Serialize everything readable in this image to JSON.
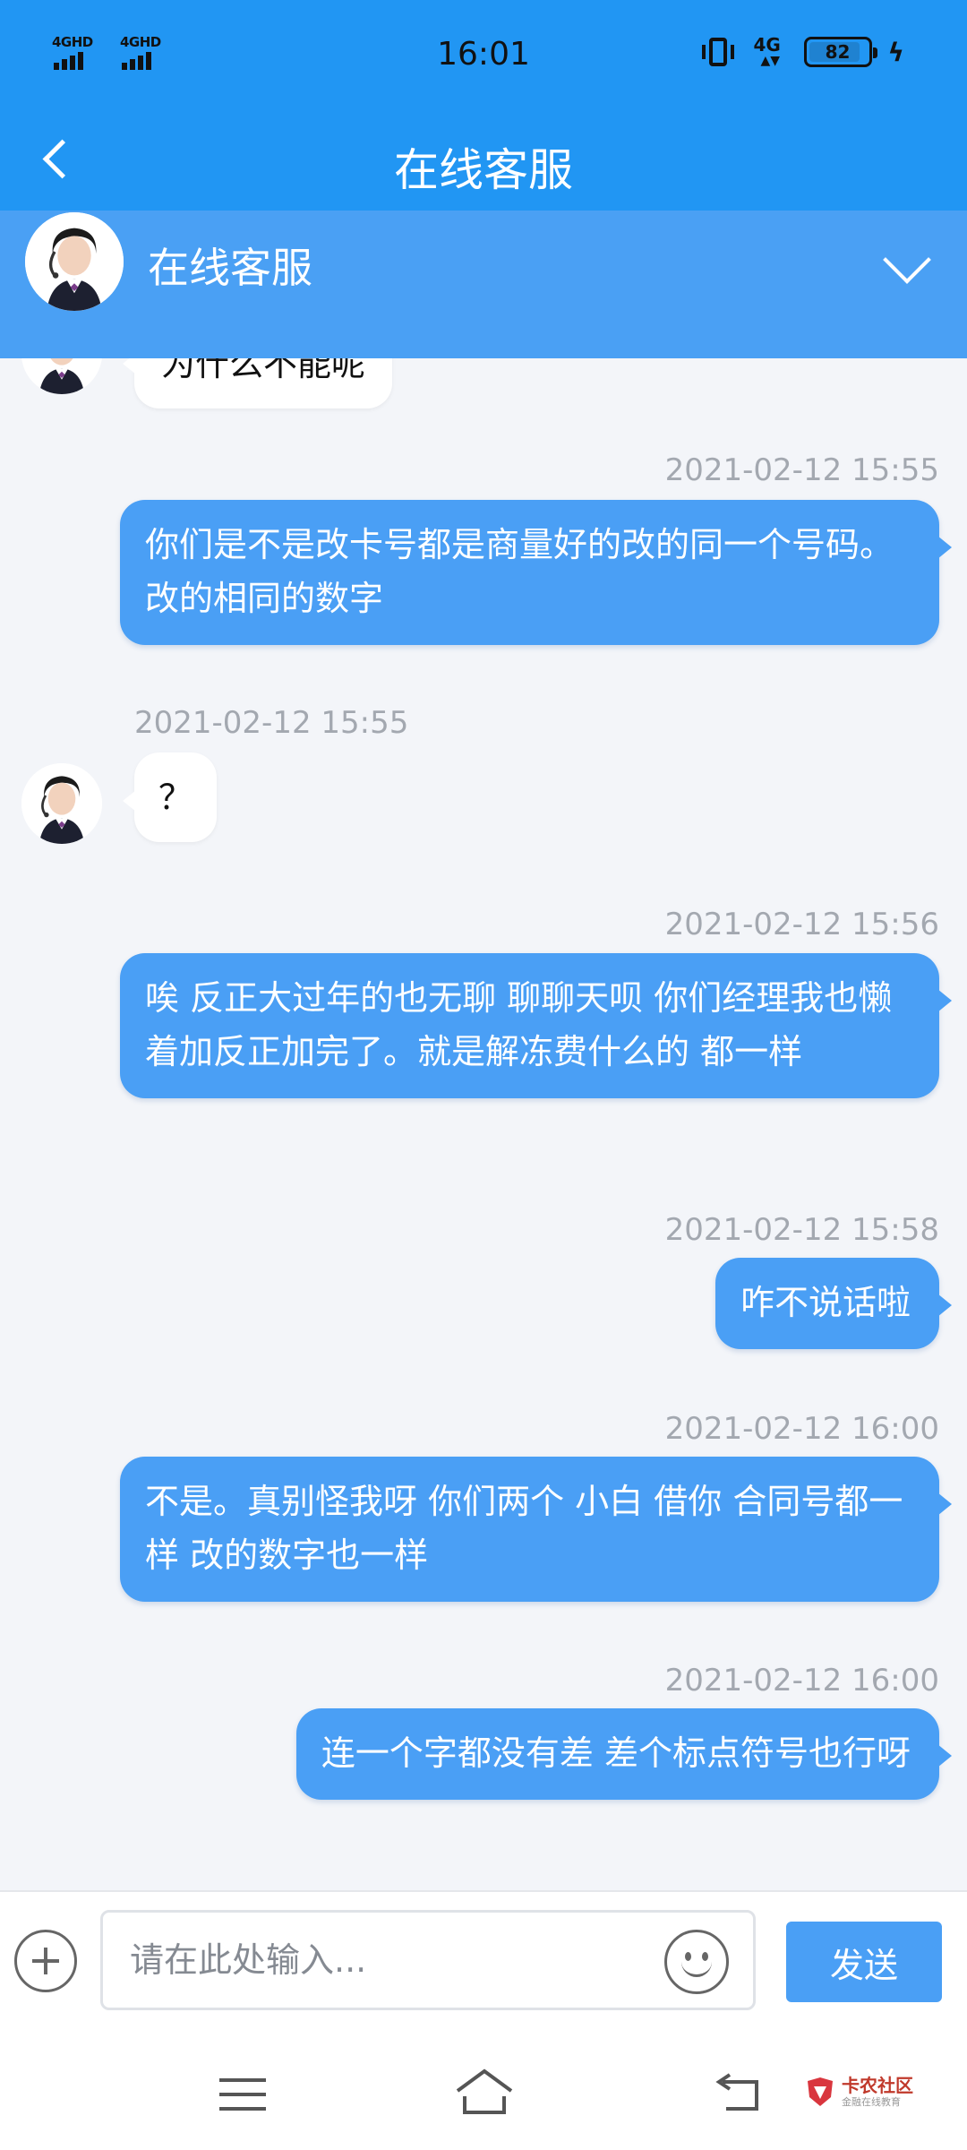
{
  "status_bar": {
    "signal_1": "4GHD",
    "signal_2": "4GHD",
    "time": "16:01",
    "network": "4G",
    "battery": "82"
  },
  "header": {
    "title": "在线客服"
  },
  "agent": {
    "name": "在线客服"
  },
  "messages": [
    {
      "side": "recv",
      "text": "为什么不能呢"
    },
    {
      "side": "sent",
      "timestamp": "2021-02-12 15:55",
      "text": "你们是不是改卡号都是商量好的改的同一个号码。改的相同的数字"
    },
    {
      "side": "recv",
      "timestamp": "2021-02-12 15:55",
      "text": "？"
    },
    {
      "side": "sent",
      "timestamp": "2021-02-12 15:56",
      "text": "唉 反正大过年的也无聊 聊聊天呗 你们经理我也懒着加反正加完了。就是解冻费什么的 都一样"
    },
    {
      "side": "sent",
      "timestamp": "2021-02-12 15:58",
      "text": "咋不说话啦"
    },
    {
      "side": "sent",
      "timestamp": "2021-02-12 16:00",
      "text": "不是。真别怪我呀 你们两个 小白 借你 合同号都一样 改的数字也一样"
    },
    {
      "side": "sent",
      "timestamp": "2021-02-12 16:00",
      "text": "连一个字都没有差 差个标点符号也行呀"
    }
  ],
  "input": {
    "placeholder": "请在此处输入...",
    "value": "",
    "send_label": "发送"
  },
  "watermark": {
    "title": "卡农社区",
    "subtitle": "金融在线教育"
  },
  "colors": {
    "header_bg": "#2196f3",
    "agent_bar_bg": "#4aa0f4",
    "sent_bubble": "#4a9ff5",
    "chat_bg": "#f3f5f9"
  }
}
